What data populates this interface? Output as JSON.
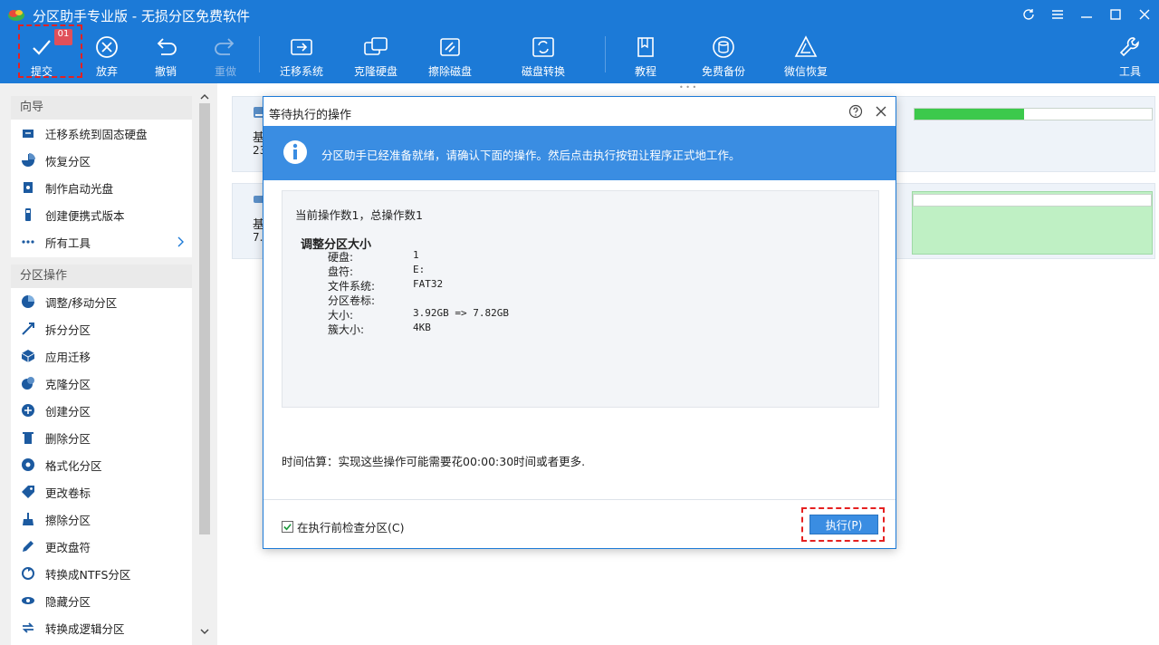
{
  "window": {
    "title": "分区助手专业版 - 无损分区免费软件"
  },
  "toolbar": {
    "submit": "提交",
    "submit_badge": "01",
    "discard": "放弃",
    "undo": "撤销",
    "redo": "重做",
    "migrate_os": "迁移系统",
    "clone_disk": "克隆硬盘",
    "wipe_disk": "擦除磁盘",
    "disk_convert": "磁盘转换",
    "tutorial": "教程",
    "free_backup": "免费备份",
    "wechat_recovery": "微信恢复",
    "tools": "工具"
  },
  "wizard": {
    "title": "向导",
    "items": [
      "迁移系统到固态硬盘",
      "恢复分区",
      "制作启动光盘",
      "创建便携式版本",
      "所有工具"
    ]
  },
  "partition_ops": {
    "title": "分区操作",
    "items": [
      "调整/移动分区",
      "拆分分区",
      "应用迁移",
      "克隆分区",
      "创建分区",
      "删除分区",
      "格式化分区",
      "更改卷标",
      "擦除分区",
      "更改盘符",
      "转换成NTFS分区",
      "隐藏分区",
      "转换成逻辑分区"
    ]
  },
  "disks": [
    {
      "t1": "基",
      "t2": "23",
      "progress": 0.46
    },
    {
      "t1": "基",
      "t2": "7."
    }
  ],
  "dialog": {
    "title": "等待执行的操作",
    "info": "分区助手已经准备就绪，请确认下面的操作。然后点击执行按钮让程序正式地工作。",
    "count_line": "当前操作数1，总操作数1",
    "operation_title": "调整分区大小",
    "details": [
      {
        "k": "硬盘:",
        "v": "1"
      },
      {
        "k": "盘符:",
        "v": "E:"
      },
      {
        "k": "文件系统:",
        "v": "FAT32"
      },
      {
        "k": "分区卷标:",
        "v": ""
      },
      {
        "k": "大小:",
        "v": "3.92GB => 7.82GB"
      },
      {
        "k": "簇大小:",
        "v": "4KB"
      }
    ],
    "time_estimate": "时间估算：实现这些操作可能需要花00:00:30时间或者更多.",
    "check_label": "在执行前检查分区(C)",
    "execute": "执行(P)"
  },
  "colors": {
    "accent": "#1c7ad7",
    "highlight": "#e52020",
    "progress": "#3cc94c"
  }
}
